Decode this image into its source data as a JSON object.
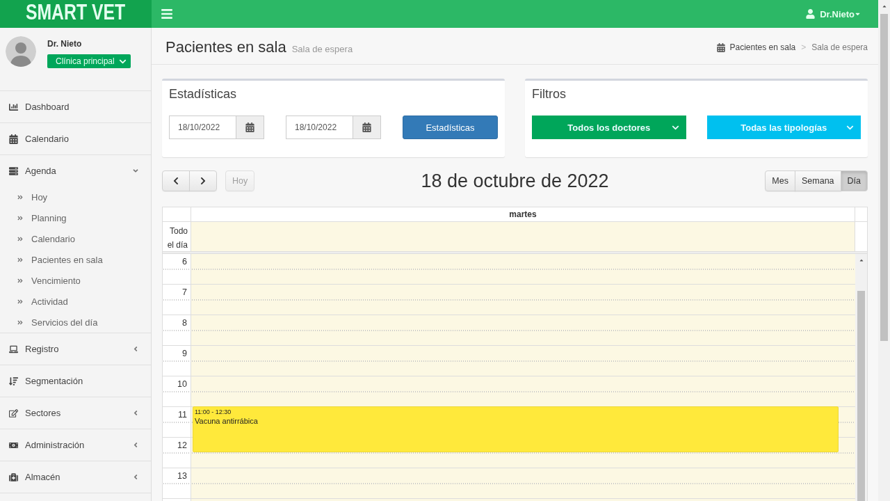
{
  "header": {
    "logo": "SMART VET",
    "user": "Dr.Nieto"
  },
  "sidebar": {
    "user": {
      "name": "Dr. Nieto",
      "clinic": "Clínica principal"
    },
    "items": [
      {
        "label": "Dashboard",
        "kind": "link"
      },
      {
        "label": "Calendario",
        "kind": "link"
      },
      {
        "label": "Agenda",
        "kind": "group",
        "expanded": true,
        "children": [
          {
            "label": "Hoy"
          },
          {
            "label": "Planning"
          },
          {
            "label": "Calendario"
          },
          {
            "label": "Pacientes en sala"
          },
          {
            "label": "Vencimiento"
          },
          {
            "label": "Actividad"
          },
          {
            "label": "Servicios del día"
          }
        ]
      },
      {
        "label": "Registro",
        "kind": "group",
        "expanded": false
      },
      {
        "label": "Segmentación",
        "kind": "link"
      },
      {
        "label": "Sectores",
        "kind": "group",
        "expanded": false
      },
      {
        "label": "Administración",
        "kind": "group",
        "expanded": false
      },
      {
        "label": "Almacén",
        "kind": "group",
        "expanded": false
      }
    ]
  },
  "page_header": {
    "title": "Pacientes en sala",
    "subtitle": "Sala de espera",
    "breadcrumb": {
      "items": [
        "Pacientes en sala",
        "Sala de espera"
      ],
      "separator": ">"
    }
  },
  "statistics": {
    "title": "Estadísticas",
    "date_from": "18/10/2022",
    "date_to": "18/10/2022",
    "button": "Estadísticas"
  },
  "filters": {
    "title": "Filtros",
    "selects": [
      {
        "value": "Todos los doctores",
        "color": "#00a65a"
      },
      {
        "value": "Todas las tipologías",
        "color": "#00c0ef"
      }
    ]
  },
  "calendar": {
    "today_button": {
      "label": "Hoy",
      "disabled": true
    },
    "title": "18 de octubre de 2022",
    "views": [
      {
        "label": "Mes",
        "selected": false
      },
      {
        "label": "Semana",
        "selected": false
      },
      {
        "label": "Día",
        "selected": true
      }
    ],
    "day_header": "martes",
    "all_day_label": "Todo el día",
    "hours": [
      {
        "label": "6"
      },
      {
        "label": "7"
      },
      {
        "label": "8"
      },
      {
        "label": "9"
      },
      {
        "label": "10"
      },
      {
        "label": "11",
        "events": [
          {
            "time": "11:00 - 12:30",
            "title": "Vacuna antirrábica",
            "color": "#ffe93b"
          }
        ]
      },
      {
        "label": "12"
      },
      {
        "label": "13"
      }
    ]
  }
}
